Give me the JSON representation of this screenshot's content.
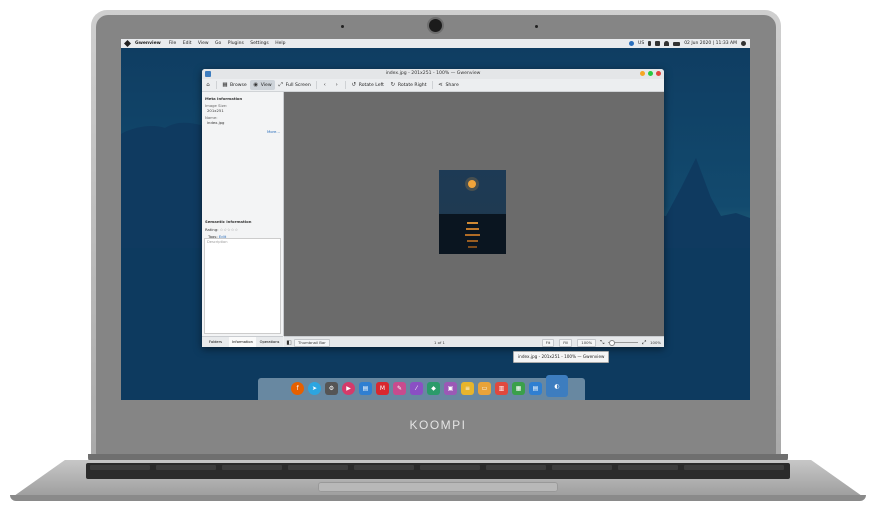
{
  "brand": "KOOMPI",
  "panel": {
    "app_name": "Gwenview",
    "menu": [
      "File",
      "Edit",
      "View",
      "Go",
      "Plugins",
      "Settings",
      "Help"
    ],
    "keyboard_layout": "US",
    "datetime": "02 Jun 2020 | 11:33 AM"
  },
  "window": {
    "title": "index.jpg - 201x251 - 100% — Gwenview",
    "toolbar": {
      "browse": "Browse",
      "view": "View",
      "full_screen": "Full Screen",
      "rotate_left": "Rotate Left",
      "rotate_right": "Rotate Right",
      "share": "Share"
    },
    "sidebar": {
      "meta_heading": "Meta Information",
      "image_size_label": "Image Size:",
      "image_size_value": "201x251",
      "name_label": "Name:",
      "name_value": "index.jpg",
      "more_link": "More...",
      "semantic_heading": "Semantic Information",
      "rating_label": "Rating:",
      "rating_value": 0,
      "tags_label": "Tags:",
      "tags_edit": "Edit",
      "description_placeholder": "Description",
      "tabs": [
        "Folders",
        "Information",
        "Operations"
      ]
    },
    "statusbar": {
      "thumbnail_bar": "Thumbnail Bar",
      "page_indicator": "1 of 1",
      "fit": "Fit",
      "fill": "Fill",
      "zoom": "100%",
      "zoom_right": "100%"
    }
  },
  "tooltip": "index.jpg - 201x251 - 100% — Gwenview",
  "dock_apps": [
    "firefox-icon",
    "telegram-icon",
    "settings-icon",
    "media-player-icon",
    "files-icon",
    "mega-icon",
    "text-editor-icon",
    "brush-icon",
    "store-icon",
    "archive-icon",
    "notes-icon",
    "presentation-icon",
    "slides-icon",
    "spreadsheet-icon",
    "document-icon",
    "gwenview-icon"
  ],
  "colors": {
    "close": "#e0443e",
    "maximize": "#27c93f",
    "minimize": "#f5a623"
  }
}
